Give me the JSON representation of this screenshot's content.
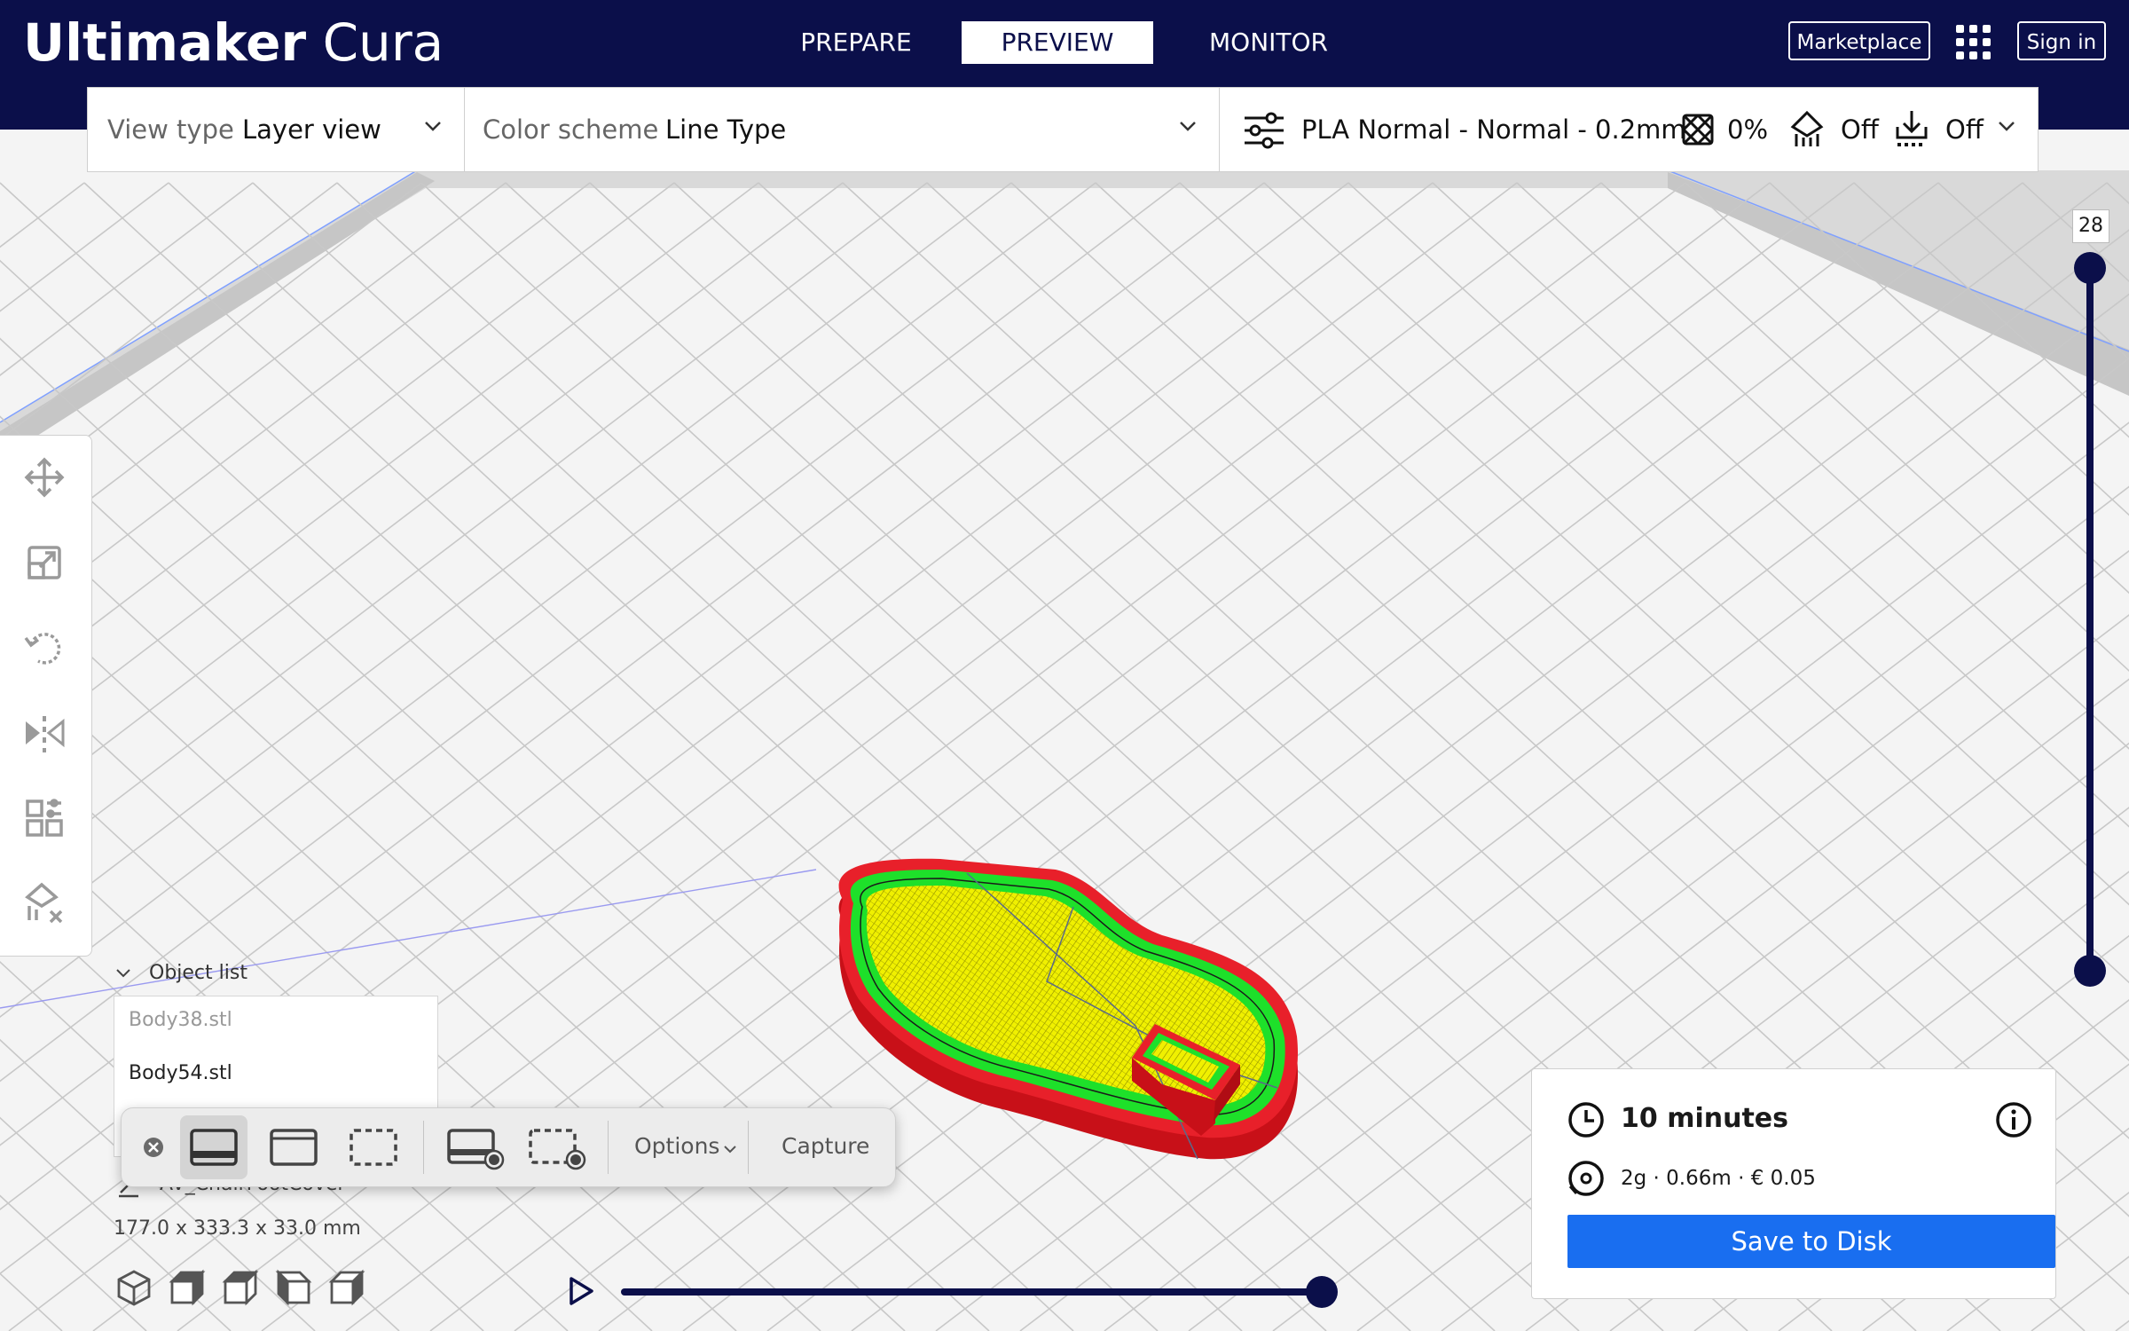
{
  "app": {
    "name_bold": "Ultimaker",
    "name_thin": "Cura"
  },
  "stages": [
    {
      "label": "PREPARE",
      "active": false
    },
    {
      "label": "PREVIEW",
      "active": true
    },
    {
      "label": "MONITOR",
      "active": false
    }
  ],
  "header": {
    "marketplace_label": "Marketplace",
    "signin_label": "Sign in",
    "apps_icon": "grid-icon"
  },
  "toolbar": {
    "view_type_label": "View type",
    "view_type_value": "Layer view",
    "color_scheme_label": "Color scheme",
    "color_scheme_value": "Line Type",
    "profile": "PLA Normal - Normal - 0.2mm",
    "infill": "0%",
    "support": "Off",
    "adhesion": "Off"
  },
  "left_tools": [
    "move-icon",
    "scale-icon",
    "rotate-icon",
    "mirror-icon",
    "per-model-settings-icon",
    "support-blocker-icon"
  ],
  "object_list": {
    "header": "Object list",
    "items": [
      "Body38.stl",
      "Body54.stl"
    ]
  },
  "screenshot_toolbar": {
    "buttons": [
      "capture-entire-screen-icon",
      "capture-window-icon",
      "capture-selection-icon",
      "record-screen-icon",
      "record-selection-icon"
    ],
    "options_label": "Options",
    "capture_label": "Capture"
  },
  "object_info": {
    "name": "AV_ChairFootCover",
    "dimensions": "177.0 x 333.3 x 33.0 mm"
  },
  "view_cube": [
    "3d-view-icon",
    "front-view-icon",
    "top-view-icon",
    "left-view-icon",
    "right-view-icon"
  ],
  "layer_slider": {
    "current_layer": "28",
    "fraction": 1.0
  },
  "path_slider": {
    "fraction": 1.0
  },
  "print_info": {
    "time": "10 minutes",
    "material": "2g · 0.66m · € 0.05",
    "save_label": "Save to Disk"
  },
  "colors": {
    "header_bg": "#0b0f4a",
    "accent_blue": "#196ef0",
    "wall_outer": "#e8202a",
    "wall_inner": "#1ee02a",
    "skin": "#f0f000"
  }
}
